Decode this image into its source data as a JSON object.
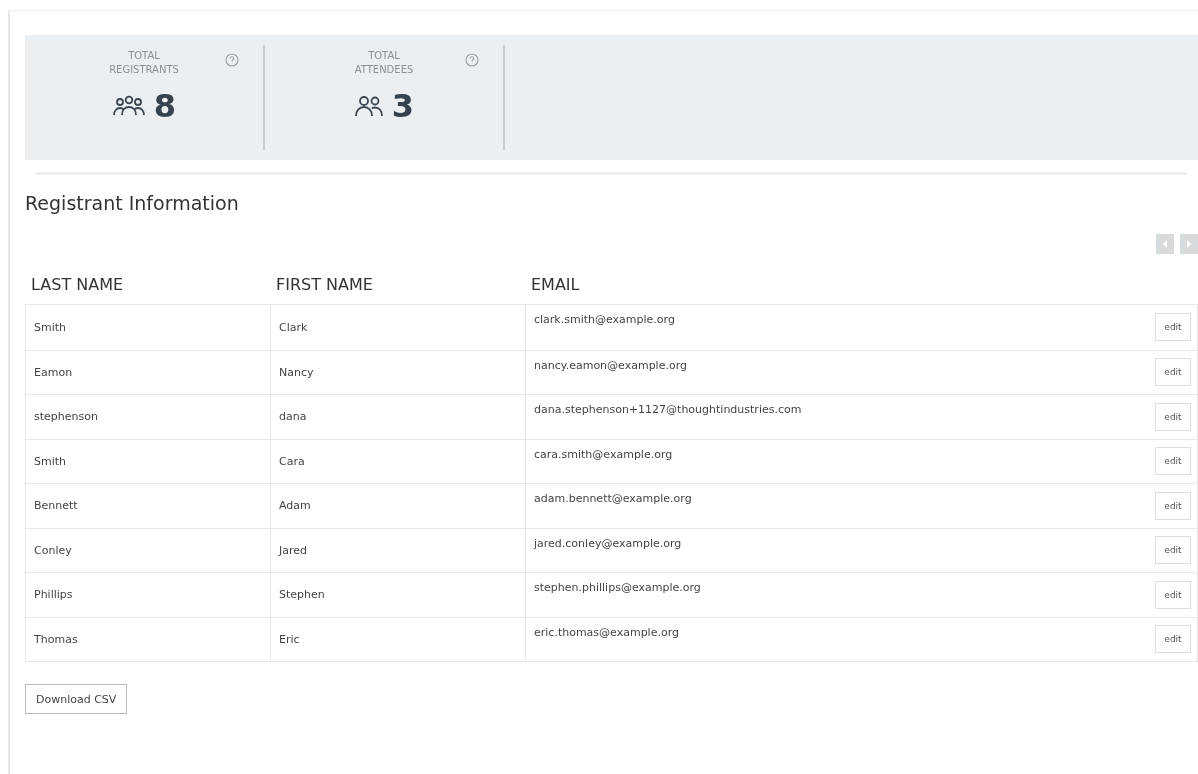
{
  "stats": [
    {
      "label": "TOTAL REGISTRANTS",
      "value": "8",
      "kind": "group"
    },
    {
      "label": "TOTAL ATTENDEES",
      "value": "3",
      "kind": "pair"
    }
  ],
  "section_title": "Registrant Information",
  "pager": {
    "prev_disabled": true,
    "next_disabled": true
  },
  "table": {
    "columns": [
      "LAST NAME",
      "FIRST NAME",
      "EMAIL"
    ],
    "rows": [
      {
        "last": "Smith",
        "first": "Clark",
        "email": "clark.smith@example.org",
        "action": "edit"
      },
      {
        "last": "Eamon",
        "first": "Nancy",
        "email": "nancy.eamon@example.org",
        "action": "edit"
      },
      {
        "last": "stephenson",
        "first": "dana",
        "email": "dana.stephenson+1127@thoughtindustries.com",
        "action": "edit"
      },
      {
        "last": "Smith",
        "first": "Cara",
        "email": "cara.smith@example.org",
        "action": "edit"
      },
      {
        "last": "Bennett",
        "first": "Adam",
        "email": "adam.bennett@example.org",
        "action": "edit"
      },
      {
        "last": "Conley",
        "first": "Jared",
        "email": "jared.conley@example.org",
        "action": "edit"
      },
      {
        "last": "Phillips",
        "first": "Stephen",
        "email": "stephen.phillips@example.org",
        "action": "edit"
      },
      {
        "last": "Thomas",
        "first": "Eric",
        "email": "eric.thomas@example.org",
        "action": "edit"
      }
    ]
  },
  "download_button": "Download CSV"
}
